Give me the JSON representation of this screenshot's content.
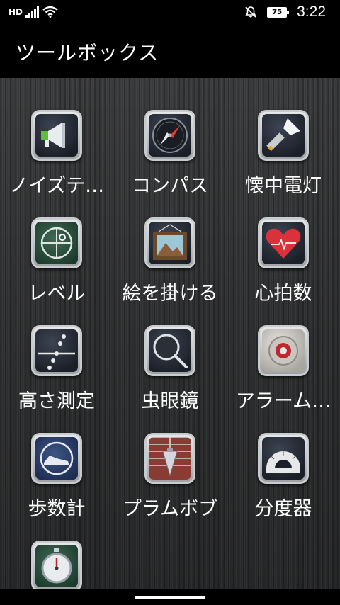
{
  "status_bar": {
    "network_label": "HD",
    "battery_level": "75",
    "time": "3:22"
  },
  "app_bar": {
    "title": "ツールボックス"
  },
  "tools": [
    {
      "label": "ノイズテ…",
      "icon": "megaphone-icon"
    },
    {
      "label": "コンパス",
      "icon": "compass-icon"
    },
    {
      "label": "懐中電灯",
      "icon": "flashlight-icon"
    },
    {
      "label": "レベル",
      "icon": "level-icon"
    },
    {
      "label": "絵を掛ける",
      "icon": "picture-frame-icon"
    },
    {
      "label": "心拍数",
      "icon": "heart-rate-icon"
    },
    {
      "label": "高さ測定",
      "icon": "height-measure-icon"
    },
    {
      "label": "虫眼鏡",
      "icon": "magnifier-icon"
    },
    {
      "label": "アラーム…",
      "icon": "alarm-icon"
    },
    {
      "label": "歩数計",
      "icon": "pedometer-icon"
    },
    {
      "label": "プラムボブ",
      "icon": "plumb-bob-icon"
    },
    {
      "label": "分度器",
      "icon": "protractor-icon"
    },
    {
      "label": "",
      "icon": "stopwatch-icon"
    }
  ],
  "colors": {
    "background": "#2e2f30",
    "icon_frame": "#c9cccf",
    "accent_heart": "#d9323b"
  }
}
